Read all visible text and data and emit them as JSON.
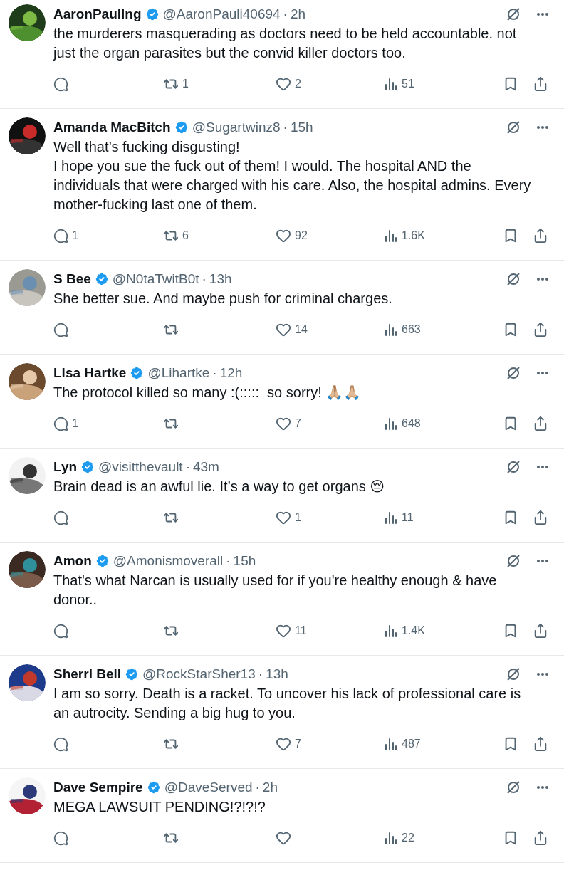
{
  "tweets": [
    {
      "name": "AaronPauling",
      "verified": true,
      "handle": "@AaronPauli40694",
      "separator": "·",
      "time": "2h",
      "text": "the murderers masquerading as doctors need to be held accountable. not just the organ parasites but the convid killer doctors too.",
      "reposts": "1",
      "likes": "2",
      "views": "51"
    },
    {
      "name": "Amanda MacBitch",
      "verified": true,
      "handle": "@Sugartwinz8",
      "separator": "·",
      "time": "15h",
      "text": "Well that’s fucking disgusting!\nI hope you sue the fuck out of them! I would. The hospital AND the individuals that were charged with his care. Also, the hospital admins. Every mother-fucking last one of them.",
      "replies": "1",
      "reposts": "6",
      "likes": "92",
      "views": "1.6K"
    },
    {
      "name": "S Bee",
      "verified": true,
      "handle": "@N0taTwitB0t",
      "separator": "·",
      "time": "13h",
      "text": "She better sue. And maybe push for criminal charges.",
      "likes": "14",
      "views": "663"
    },
    {
      "name": "Lisa Hartke",
      "verified": true,
      "handle": "@Lihartke",
      "separator": "·",
      "time": "12h",
      "text": "The protocol killed so many :(:::::  so sorry! 🙏🏼🙏🏼",
      "replies": "1",
      "likes": "7",
      "views": "648"
    },
    {
      "name": "Lyn",
      "verified": true,
      "handle": "@visitthevault",
      "separator": "·",
      "time": "43m",
      "text": "Brain dead is an awful lie. It’s a way to get organs 😔",
      "likes": "1",
      "views": "11"
    },
    {
      "name": "Amon",
      "verified": true,
      "handle": "@Amonismoverall",
      "separator": "·",
      "time": "15h",
      "text": "That's what Narcan is usually used for if you're healthy enough & have donor..",
      "likes": "11",
      "views": "1.4K"
    },
    {
      "name": "Sherri Bell",
      "verified": true,
      "handle": "@RockStarSher13",
      "separator": "·",
      "time": "13h",
      "text": "I am so sorry. Death is a racket. To uncover his lack of professional care is an autrocity. Sending a big hug to you.",
      "likes": "7",
      "views": "487"
    },
    {
      "name": "Dave Sempire",
      "verified": true,
      "handle": "@DaveServed",
      "separator": "·",
      "time": "2h",
      "text": "MEGA LAWSUIT PENDING!?!?!?",
      "views": "22"
    }
  ]
}
